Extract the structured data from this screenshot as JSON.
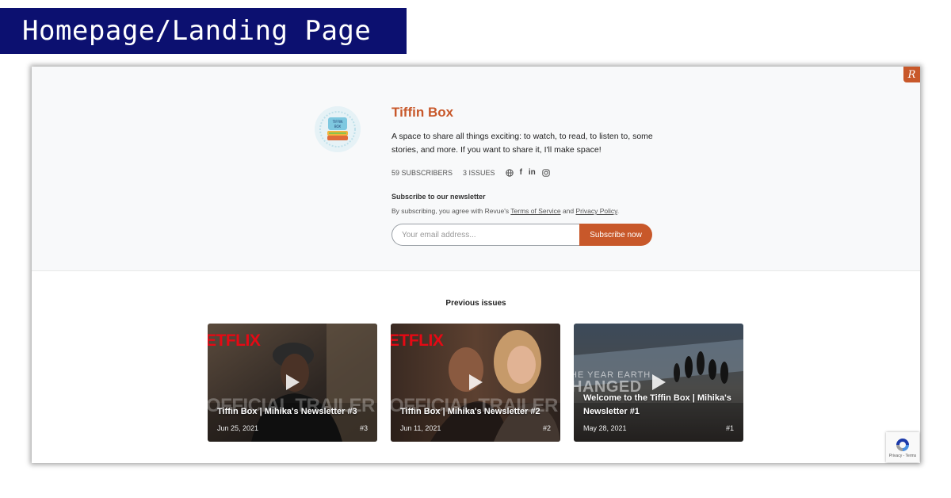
{
  "banner": {
    "label": "Homepage/Landing Page"
  },
  "header": {
    "badge": "R",
    "avatar_text": "TIFFIN BOX",
    "title": "Tiffin Box",
    "description": "A space to share all things exciting: to watch, to read, to listen to, some stories, and more. If you want to share it, I'll make space!",
    "subscribers": "59 SUBSCRIBERS",
    "issues": "3 ISSUES",
    "social_icons": [
      "globe-icon",
      "facebook-icon",
      "linkedin-icon",
      "instagram-icon"
    ],
    "social_labels": {
      "facebook": "f",
      "linkedin": "in"
    }
  },
  "subscribe": {
    "heading": "Subscribe to our newsletter",
    "terms_prefix": "By subscribing, you agree with Revue's ",
    "terms_link": "Terms of Service",
    "terms_and": " and ",
    "privacy_link": "Privacy Policy",
    "terms_suffix": ".",
    "email_placeholder": "Your email address...",
    "button_label": "Subscribe now"
  },
  "previous": {
    "heading": "Previous issues",
    "cards": [
      {
        "title": "Tiffin Box | Mihika's Newsletter #3",
        "date": "Jun 25, 2021",
        "number": "#3",
        "brand": "ETFLIX",
        "overlay": "OFFICIAL TRAILER"
      },
      {
        "title": "Tiffin Box | Mihika's Newsletter #2",
        "date": "Jun 11, 2021",
        "number": "#2",
        "brand": "ETFLIX",
        "overlay": "OFFICIAL TRAILER"
      },
      {
        "title": "Welcome to the Tiffin Box | Mihika's Newsletter #1",
        "date": "May 28, 2021",
        "number": "#1",
        "overlay_top": "HE YEAR EARTH",
        "overlay_big": "HANGED"
      }
    ]
  },
  "recaptcha": {
    "text": "Privacy - Terms"
  },
  "colors": {
    "accent": "#c8582a",
    "banner": "#0c1070",
    "header_bg": "#f8f9fa"
  }
}
